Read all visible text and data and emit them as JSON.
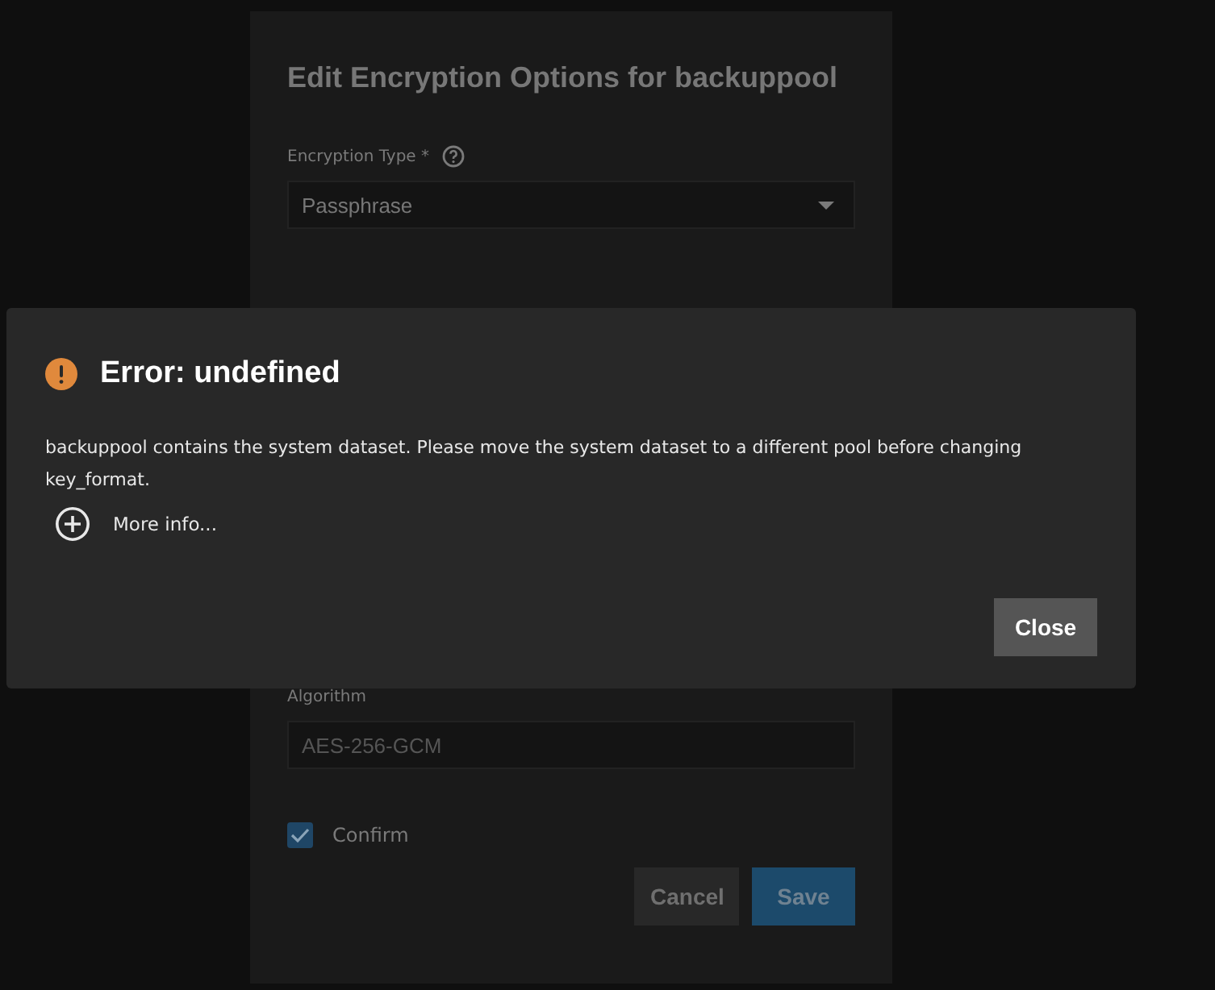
{
  "form_dialog": {
    "title": "Edit Encryption Options for backuppool",
    "fields": [
      {
        "kind": "select",
        "label": "Encryption Type *",
        "help": true,
        "value": "Passphrase"
      },
      {
        "kind": "text",
        "label": "Algorithm",
        "help": false,
        "value": "AES-256-GCM"
      }
    ],
    "confirm": {
      "label": "Confirm",
      "checked": true
    },
    "buttons": [
      {
        "label": "Cancel",
        "kind": "secondary"
      },
      {
        "label": "Save",
        "kind": "primary"
      }
    ]
  },
  "error_dialog": {
    "title": "Error: undefined",
    "message": "backuppool contains the system dataset. Please move the system dataset to a different pool before changing key_format.",
    "more_info": "More info...",
    "button": "Close"
  }
}
